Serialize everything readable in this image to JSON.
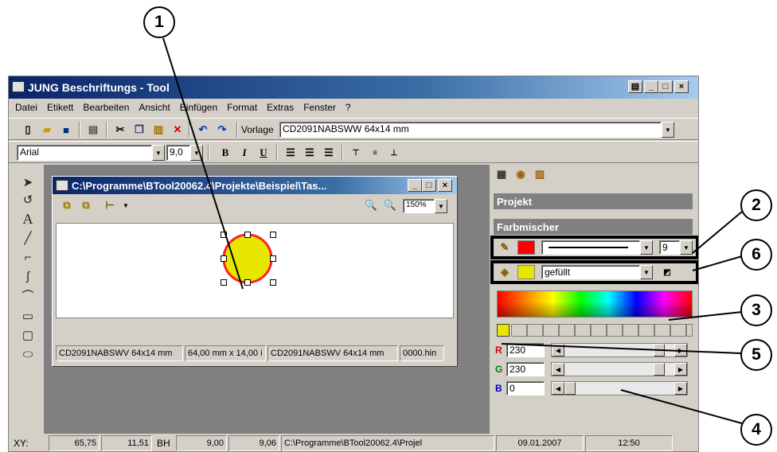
{
  "callouts": [
    "1",
    "2",
    "6",
    "3",
    "5",
    "4"
  ],
  "app": {
    "title": "JUNG Beschriftungs - Tool",
    "menu": [
      "Datei",
      "Etikett",
      "Bearbeiten",
      "Ansicht",
      "Einfügen",
      "Format",
      "Extras",
      "Fenster",
      "?"
    ],
    "template_label": "Vorlage",
    "template_value": "CD2091NABSWW 64x14 mm",
    "font_name": "Arial",
    "font_size": "9,0",
    "bold": "B",
    "italic": "I",
    "underline": "U"
  },
  "child_window": {
    "title": "C:\\Programme\\BTool20062.4\\Projekte\\Beispiel\\Tas...",
    "zoom": "150%",
    "status": [
      "CD2091NABSWV 64x14 mm",
      "64,00 mm x 14,00 i",
      "CD2091NABSWV 64x14 mm",
      "0000.hin"
    ]
  },
  "panel": {
    "projekt": "Projekt",
    "farbmischer": "Farbmischer",
    "line_width": "9",
    "fill_mode": "gefüllt",
    "r_label": "R",
    "g_label": "G",
    "b_label": "B",
    "r_value": "230",
    "g_value": "230",
    "b_value": "0",
    "r_level": 0.9,
    "g_level": 0.9,
    "b_level": 0.0
  },
  "status": {
    "xy_label": "XY:",
    "x": "65,75",
    "y": "11,51",
    "bh_label": "BH",
    "b": "9,00",
    "h": "9,06",
    "path": "C:\\Programme\\BTool20062.4\\Projel",
    "date": "09.01.2007",
    "time": "12:50"
  },
  "colors": {
    "title_blue": "#0a246a",
    "line_color": "#ff0000",
    "fill_color": "#e6e600",
    "circle_outline": "#ff2020"
  },
  "icons": [
    "arrow-pointer-icon",
    "rotate-icon",
    "text-icon",
    "line-icon",
    "polyline-icon",
    "curve-icon",
    "arc-icon",
    "rectangle-icon",
    "rounded-rect-icon",
    "ellipse-icon"
  ]
}
